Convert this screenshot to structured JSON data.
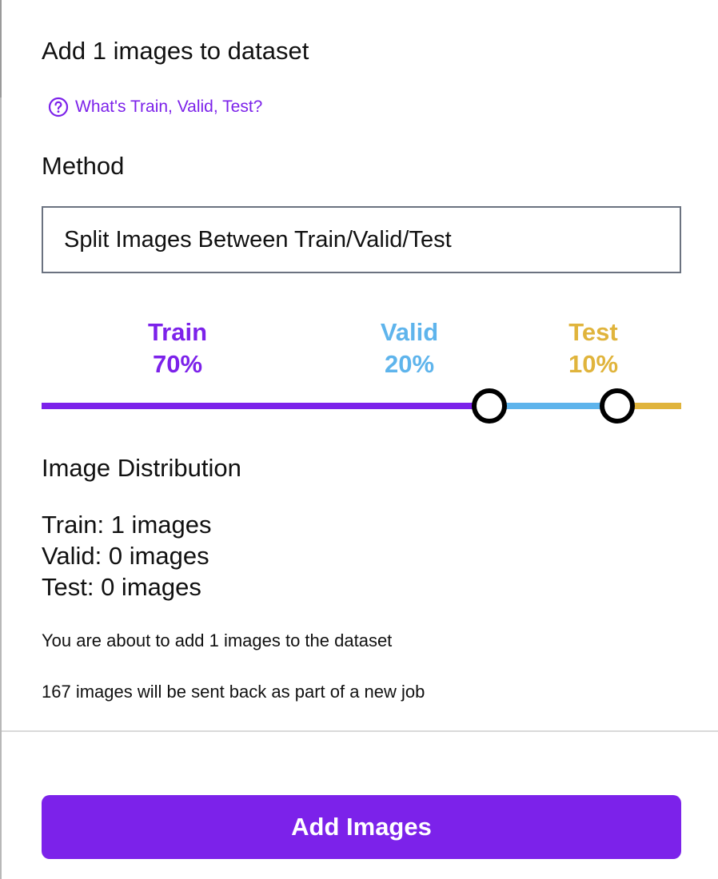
{
  "header": {
    "title": "Add 1 images to dataset",
    "help_link": "What's Train, Valid, Test?",
    "help_icon": "question-circle-icon"
  },
  "method": {
    "label": "Method",
    "selected": "Split Images Between Train/Valid/Test"
  },
  "split": {
    "train": {
      "label": "Train",
      "percent": "70%",
      "value": 70,
      "color": "#7c22ea"
    },
    "valid": {
      "label": "Valid",
      "percent": "20%",
      "value": 20,
      "color": "#5eb4ec"
    },
    "test": {
      "label": "Test",
      "percent": "10%",
      "value": 10,
      "color": "#e0b43c"
    }
  },
  "distribution": {
    "heading": "Image Distribution",
    "train": "Train: 1 images",
    "valid": "Valid: 0 images",
    "test": "Test: 0 images"
  },
  "notes": {
    "add_summary": "You are about to add 1 images to the dataset",
    "sent_back": "167 images will be sent back as part of a new job"
  },
  "actions": {
    "add_images": "Add Images",
    "accent_color": "#7c22ea"
  }
}
